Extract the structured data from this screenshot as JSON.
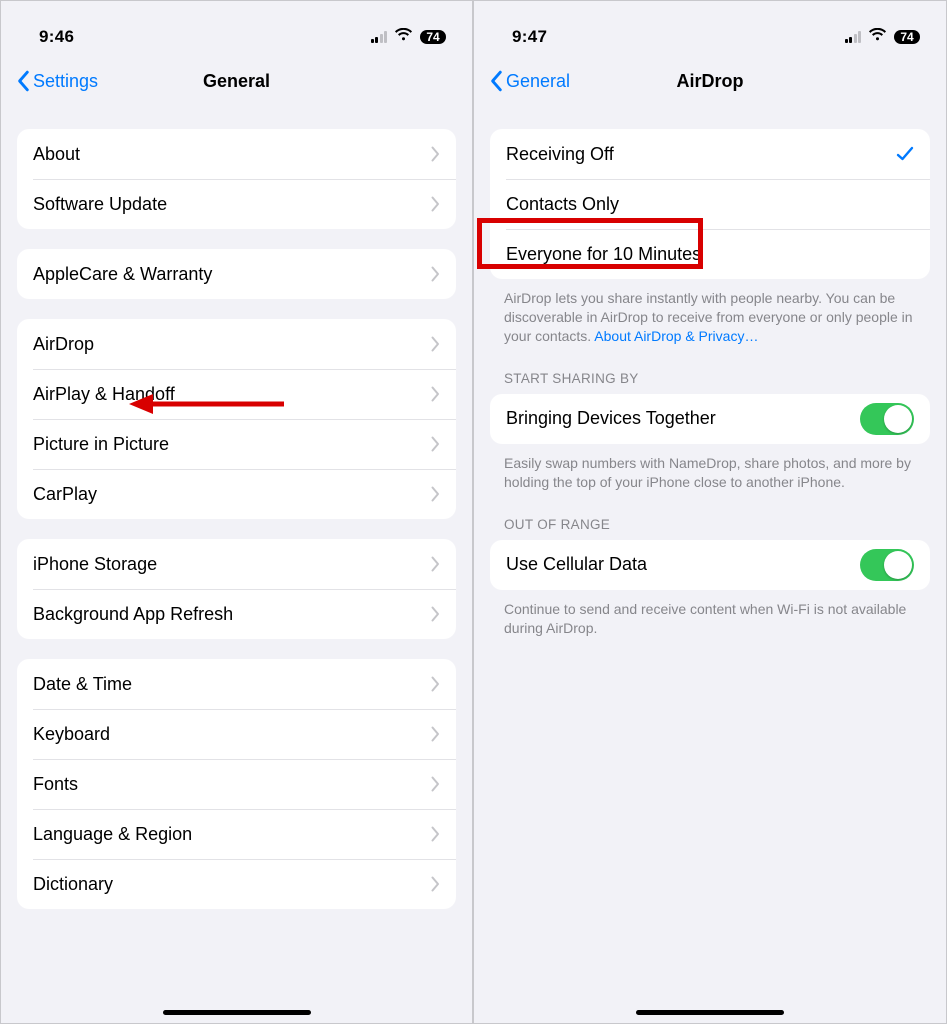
{
  "left": {
    "status": {
      "time": "9:46",
      "battery": "74"
    },
    "nav": {
      "back": "Settings",
      "title": "General"
    },
    "groups": [
      {
        "rows": [
          {
            "label": "About"
          },
          {
            "label": "Software Update"
          }
        ]
      },
      {
        "rows": [
          {
            "label": "AppleCare & Warranty"
          }
        ]
      },
      {
        "rows": [
          {
            "label": "AirDrop"
          },
          {
            "label": "AirPlay & Handoff"
          },
          {
            "label": "Picture in Picture"
          },
          {
            "label": "CarPlay"
          }
        ]
      },
      {
        "rows": [
          {
            "label": "iPhone Storage"
          },
          {
            "label": "Background App Refresh"
          }
        ]
      },
      {
        "rows": [
          {
            "label": "Date & Time"
          },
          {
            "label": "Keyboard"
          },
          {
            "label": "Fonts"
          },
          {
            "label": "Language & Region"
          },
          {
            "label": "Dictionary"
          }
        ]
      }
    ]
  },
  "right": {
    "status": {
      "time": "9:47",
      "battery": "74"
    },
    "nav": {
      "back": "General",
      "title": "AirDrop"
    },
    "receive_options": {
      "rows": [
        {
          "label": "Receiving Off",
          "selected": true
        },
        {
          "label": "Contacts Only"
        },
        {
          "label": "Everyone for 10 Minutes"
        }
      ],
      "footer_text": "AirDrop lets you share instantly with people nearby. You can be discoverable in AirDrop to receive from everyone or only people in your contacts. ",
      "footer_link": "About AirDrop & Privacy…"
    },
    "sharing": {
      "header": "Start Sharing By",
      "row": {
        "label": "Bringing Devices Together"
      },
      "footer": "Easily swap numbers with NameDrop, share photos, and more by holding the top of your iPhone close to another iPhone."
    },
    "cellular": {
      "header": "Out of Range",
      "row": {
        "label": "Use Cellular Data"
      },
      "footer": "Continue to send and receive content when Wi-Fi is not available during AirDrop."
    }
  }
}
